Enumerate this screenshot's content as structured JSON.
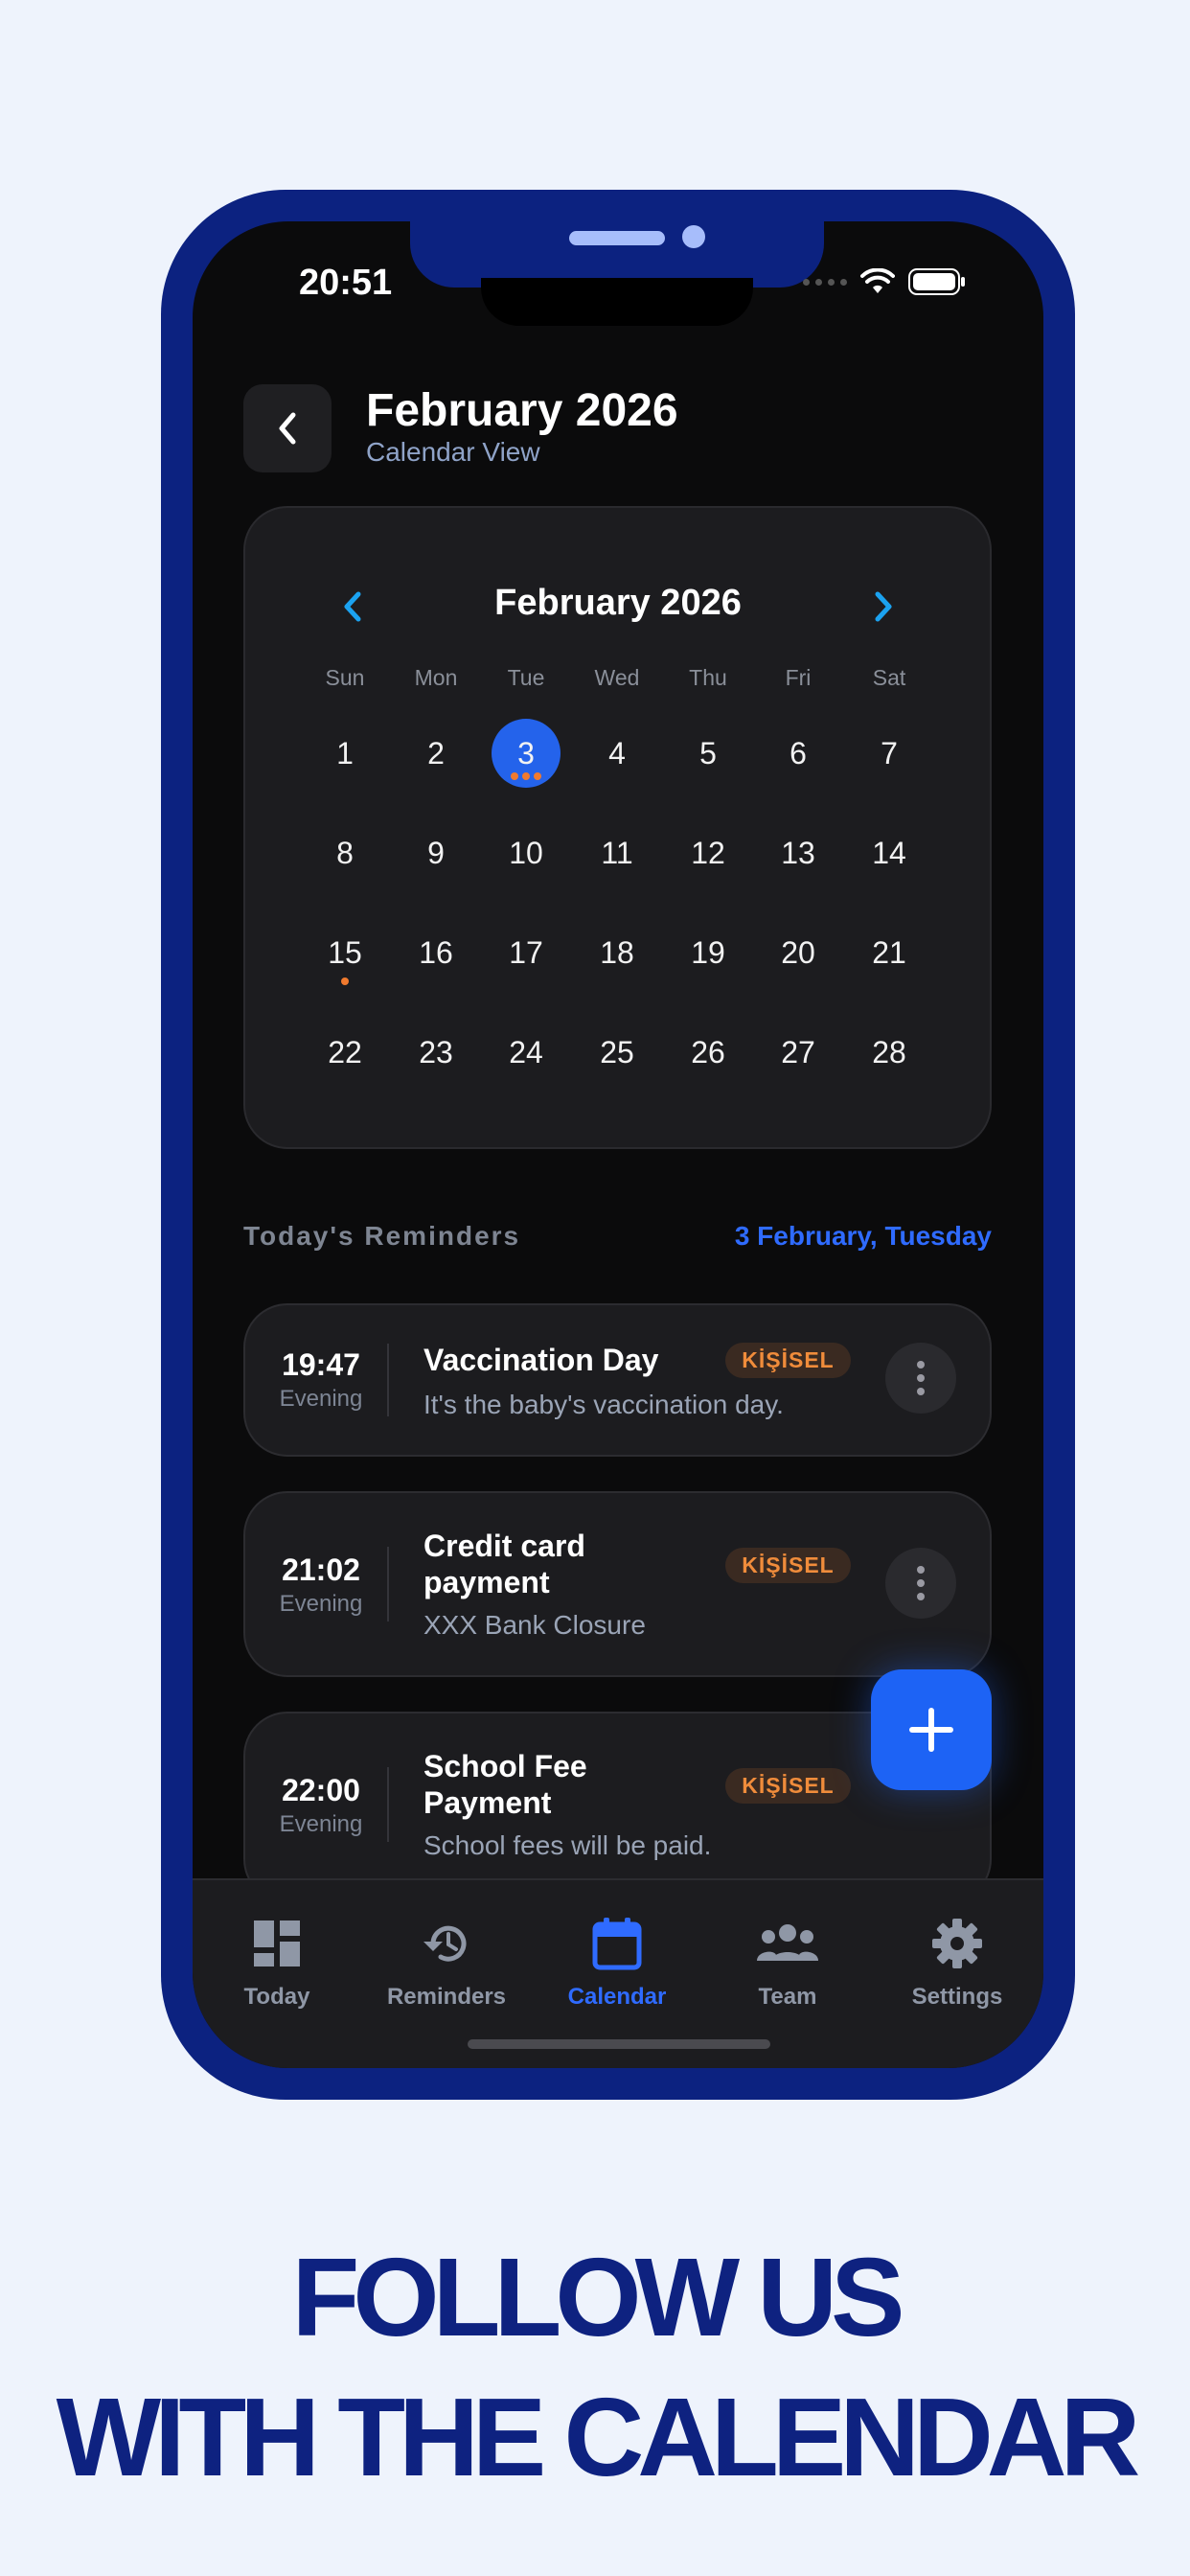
{
  "status": {
    "time": "20:51"
  },
  "header": {
    "title": "February 2026",
    "subtitle": "Calendar View"
  },
  "calendar": {
    "month_label": "February 2026",
    "weekdays": [
      "Sun",
      "Mon",
      "Tue",
      "Wed",
      "Thu",
      "Fri",
      "Sat"
    ],
    "weeks": [
      [
        "1",
        "2",
        "3",
        "4",
        "5",
        "6",
        "7"
      ],
      [
        "8",
        "9",
        "10",
        "11",
        "12",
        "13",
        "14"
      ],
      [
        "15",
        "16",
        "17",
        "18",
        "19",
        "20",
        "21"
      ],
      [
        "22",
        "23",
        "24",
        "25",
        "26",
        "27",
        "28"
      ]
    ],
    "selected_day": "3",
    "event_dots": {
      "3": 3,
      "15": 1
    }
  },
  "reminders_section": {
    "title": "Today's Reminders",
    "date": "3 February, Tuesday"
  },
  "reminders": [
    {
      "time": "19:47",
      "period": "Evening",
      "title": "Vaccination Day",
      "description": "It's the baby's vaccination day.",
      "tag": "KİŞİSEL"
    },
    {
      "time": "21:02",
      "period": "Evening",
      "title": "Credit card payment",
      "description": "XXX Bank Closure",
      "tag": "KİŞİSEL"
    },
    {
      "time": "22:00",
      "period": "Evening",
      "title": "School Fee Payment",
      "description": "School fees will be paid.",
      "tag": "KİŞİSEL"
    }
  ],
  "tabs": [
    {
      "label": "Today",
      "icon": "dashboard-icon",
      "active": false
    },
    {
      "label": "Reminders",
      "icon": "history-icon",
      "active": false
    },
    {
      "label": "Calendar",
      "icon": "calendar-icon",
      "active": true
    },
    {
      "label": "Team",
      "icon": "team-icon",
      "active": false
    },
    {
      "label": "Settings",
      "icon": "gear-icon",
      "active": false
    }
  ],
  "promo": {
    "line1": "FOLLOW US",
    "line2": "WITH THE CALENDAR"
  },
  "colors": {
    "accent": "#2463eb",
    "tag_text": "#f08c3b",
    "frame": "#0c2280",
    "background": "#eef3fc"
  }
}
